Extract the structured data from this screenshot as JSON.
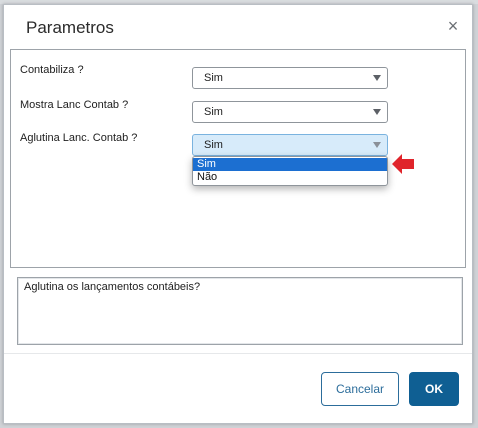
{
  "dialog": {
    "title": "Parametros",
    "close_glyph": "×"
  },
  "fields": [
    {
      "label": "Contabiliza ?",
      "value": "Sim"
    },
    {
      "label": "Mostra Lanc Contab ?",
      "value": "Sim"
    },
    {
      "label": "Aglutina Lanc. Contab ?",
      "value": "Sim"
    }
  ],
  "dropdown": {
    "options": [
      "Sim",
      "Não"
    ],
    "selected": "Sim"
  },
  "description": "Aglutina os lançamentos contábeis?",
  "buttons": {
    "cancel": "Cancelar",
    "ok": "OK"
  },
  "colors": {
    "accent": "#0f5f93",
    "selected_option": "#1c6fd1",
    "pointer_arrow": "#e0242b"
  },
  "icons": {
    "close": "close-icon",
    "pointer": "red-arrow-icon",
    "dropdown": "chevron-down-icon"
  }
}
